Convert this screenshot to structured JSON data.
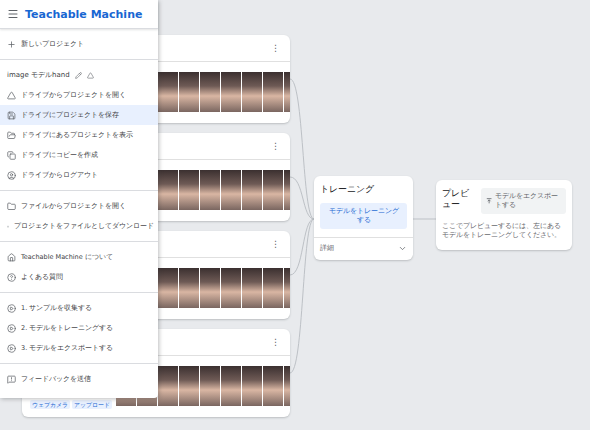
{
  "app": {
    "title": "Teachable Machine"
  },
  "menu": {
    "sections": [
      [
        {
          "kind": "item",
          "label": "新しいプロジェクト",
          "selected": false
        }
      ],
      [
        {
          "kind": "title",
          "label": "image モデルhand",
          "selected": false
        },
        {
          "kind": "item",
          "label": "ドライブからプロジェクトを開く",
          "selected": false
        },
        {
          "kind": "item",
          "label": "ドライブにプロジェクトを保存",
          "selected": true
        },
        {
          "kind": "item",
          "label": "ドライブにあるプロジェクトを表示",
          "selected": false
        },
        {
          "kind": "item",
          "label": "ドライブにコピーを作成",
          "selected": false
        },
        {
          "kind": "item",
          "label": "ドライブからログアウト",
          "selected": false
        }
      ],
      [
        {
          "kind": "item",
          "label": "ファイルからプロジェクトを開く",
          "selected": false
        },
        {
          "kind": "item",
          "label": "プロジェクトをファイルとしてダウンロード",
          "selected": false
        }
      ],
      [
        {
          "kind": "item",
          "label": "Teachable Machine について",
          "selected": false
        },
        {
          "kind": "item",
          "label": "よくある質問",
          "selected": false
        }
      ],
      [
        {
          "kind": "item",
          "label": "1. サンプルを収集する",
          "selected": false
        },
        {
          "kind": "item",
          "label": "2. モデルをトレーニングする",
          "selected": false
        },
        {
          "kind": "item",
          "label": "3. モデルをエクスポートする",
          "selected": false
        }
      ],
      [
        {
          "kind": "item",
          "label": "フィードバックを送信",
          "selected": false
        }
      ]
    ]
  },
  "classes": [
    {
      "menu": "⋮",
      "buttons": [],
      "samples_shown": 9
    },
    {
      "menu": "⋮",
      "buttons": [],
      "samples_shown": 9
    },
    {
      "menu": "⋮",
      "buttons": [],
      "samples_shown": 9
    },
    {
      "menu": "⋮",
      "buttons": [
        "ウェブカメラ",
        "アップロード"
      ],
      "samples_shown": 9
    }
  ],
  "training": {
    "title": "トレーニング",
    "button": "モデルをトレーニングする",
    "details": "詳細"
  },
  "preview": {
    "title": "プレビュー",
    "export_button": "モデルをエクスポートする",
    "hint": "ここでプレビューするには、左にあるモデルをトレーニングしてください。"
  }
}
